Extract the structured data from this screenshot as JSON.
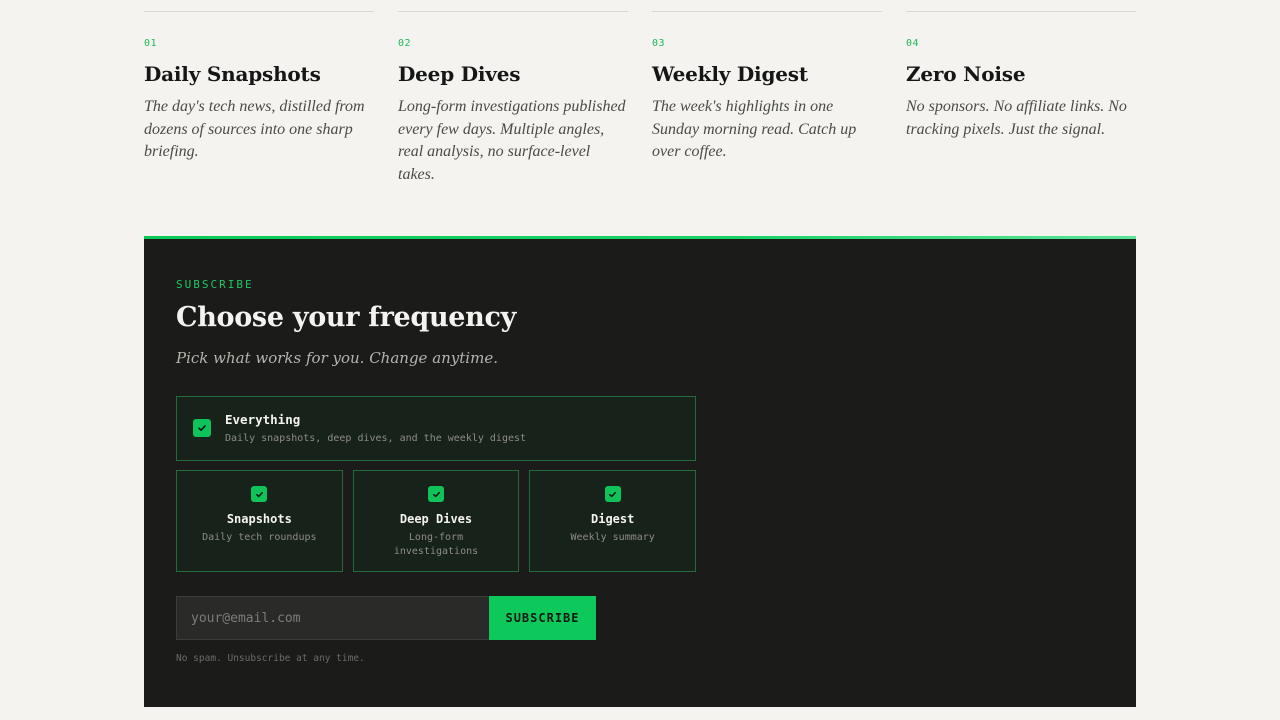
{
  "features": [
    {
      "number": "01",
      "title": "Daily Snapshots",
      "description": "The day's tech news, distilled from dozens of sources into one sharp briefing."
    },
    {
      "number": "02",
      "title": "Deep Dives",
      "description": "Long-form investigations published every few days. Multiple angles, real analysis, no surface-level takes."
    },
    {
      "number": "03",
      "title": "Weekly Digest",
      "description": "The week's highlights in one Sunday morning read. Catch up over coffee."
    },
    {
      "number": "04",
      "title": "Zero Noise",
      "description": "No sponsors. No affiliate links. No tracking pixels. Just the signal."
    }
  ],
  "subscribe": {
    "eyebrow": "SUBSCRIBE",
    "title": "Choose your frequency",
    "subtitle": "Pick what works for you. Change anytime.",
    "everything": {
      "title": "Everything",
      "description": "Daily snapshots, deep dives, and the weekly digest",
      "checked": true,
      "icon": "check-icon"
    },
    "options": [
      {
        "title": "Snapshots",
        "description": "Daily tech roundups",
        "checked": true,
        "icon": "check-icon"
      },
      {
        "title": "Deep Dives",
        "description": "Long-form investigations",
        "checked": true,
        "icon": "check-icon"
      },
      {
        "title": "Digest",
        "description": "Weekly summary",
        "checked": true,
        "icon": "check-icon"
      }
    ],
    "email_placeholder": "your@email.com",
    "email_value": "",
    "button_label": "SUBSCRIBE",
    "fine_print": "No spam. Unsubscribe at any time."
  },
  "colors": {
    "accent": "#0dc85a",
    "panel_background": "#1b1b1a",
    "page_background": "#f4f3ef"
  }
}
